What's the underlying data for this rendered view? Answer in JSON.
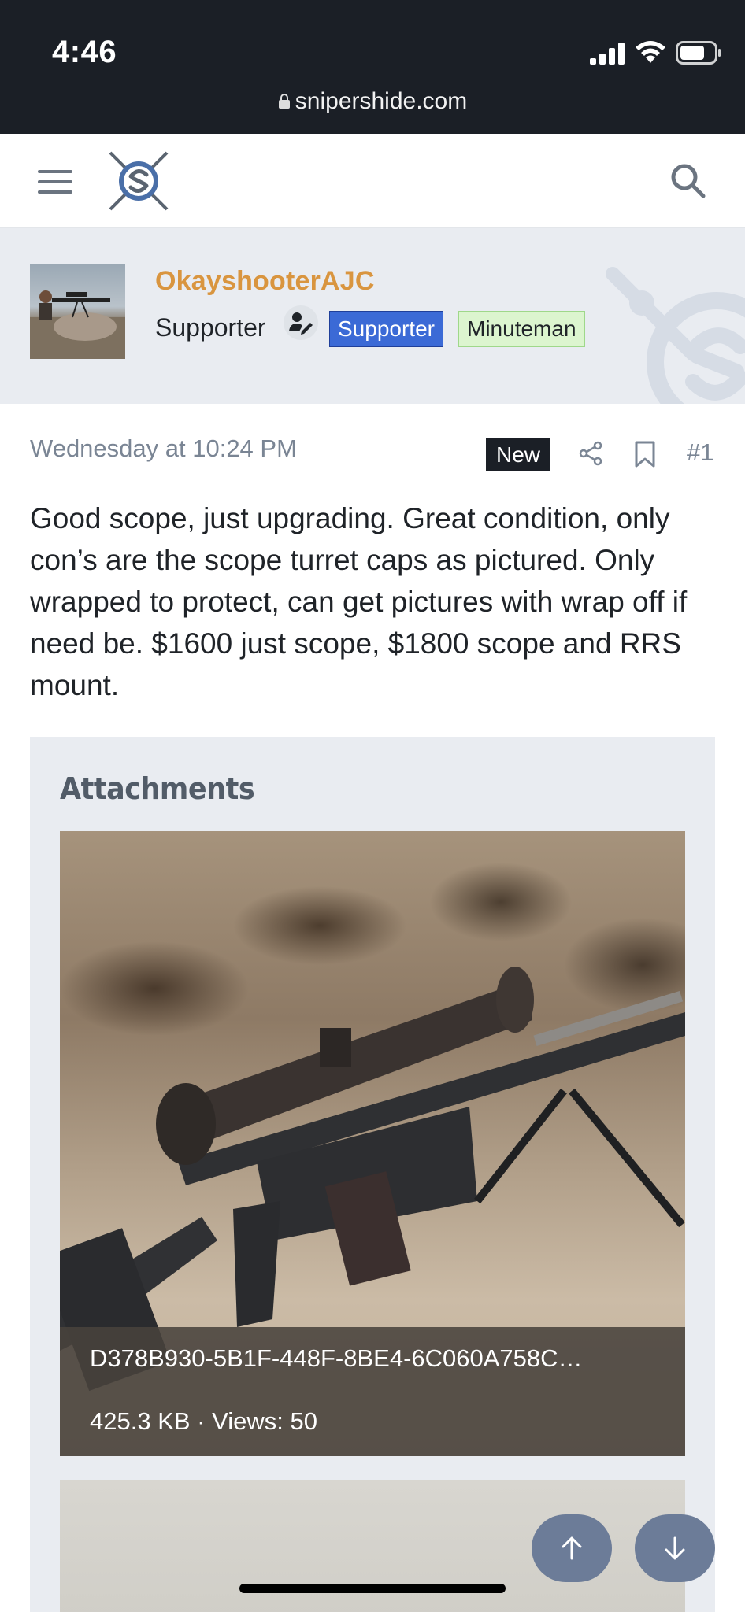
{
  "status_bar": {
    "time": "4:46",
    "url": "snipershide.com"
  },
  "header": {
    "menu_icon": "hamburger-icon",
    "logo_icon": "snipershide-logo",
    "search_icon": "search-icon"
  },
  "author": {
    "username": "OkayshooterAJC",
    "user_title": "Supporter",
    "badges": [
      "Supporter",
      "Minuteman"
    ],
    "colors": {
      "username": "#d9953f",
      "supporter_badge": "#3b6ad6",
      "minuteman_badge": "#dcf5cf"
    }
  },
  "post": {
    "date": "Wednesday at 10:24 PM",
    "new_label": "New",
    "number": "#1",
    "body": "Good scope, just upgrading. Great condition, only con’s are the scope turret caps as pictured. Only wrapped to protect, can get pictures with wrap off if need be. $1600 just scope, $1800 scope and RRS mount."
  },
  "attachments": {
    "title": "Attachments",
    "items": [
      {
        "filename": "D378B930-5B1F-448F-8BE4-6C060A758C…",
        "meta": "425.3 KB · Views: 50"
      }
    ]
  }
}
